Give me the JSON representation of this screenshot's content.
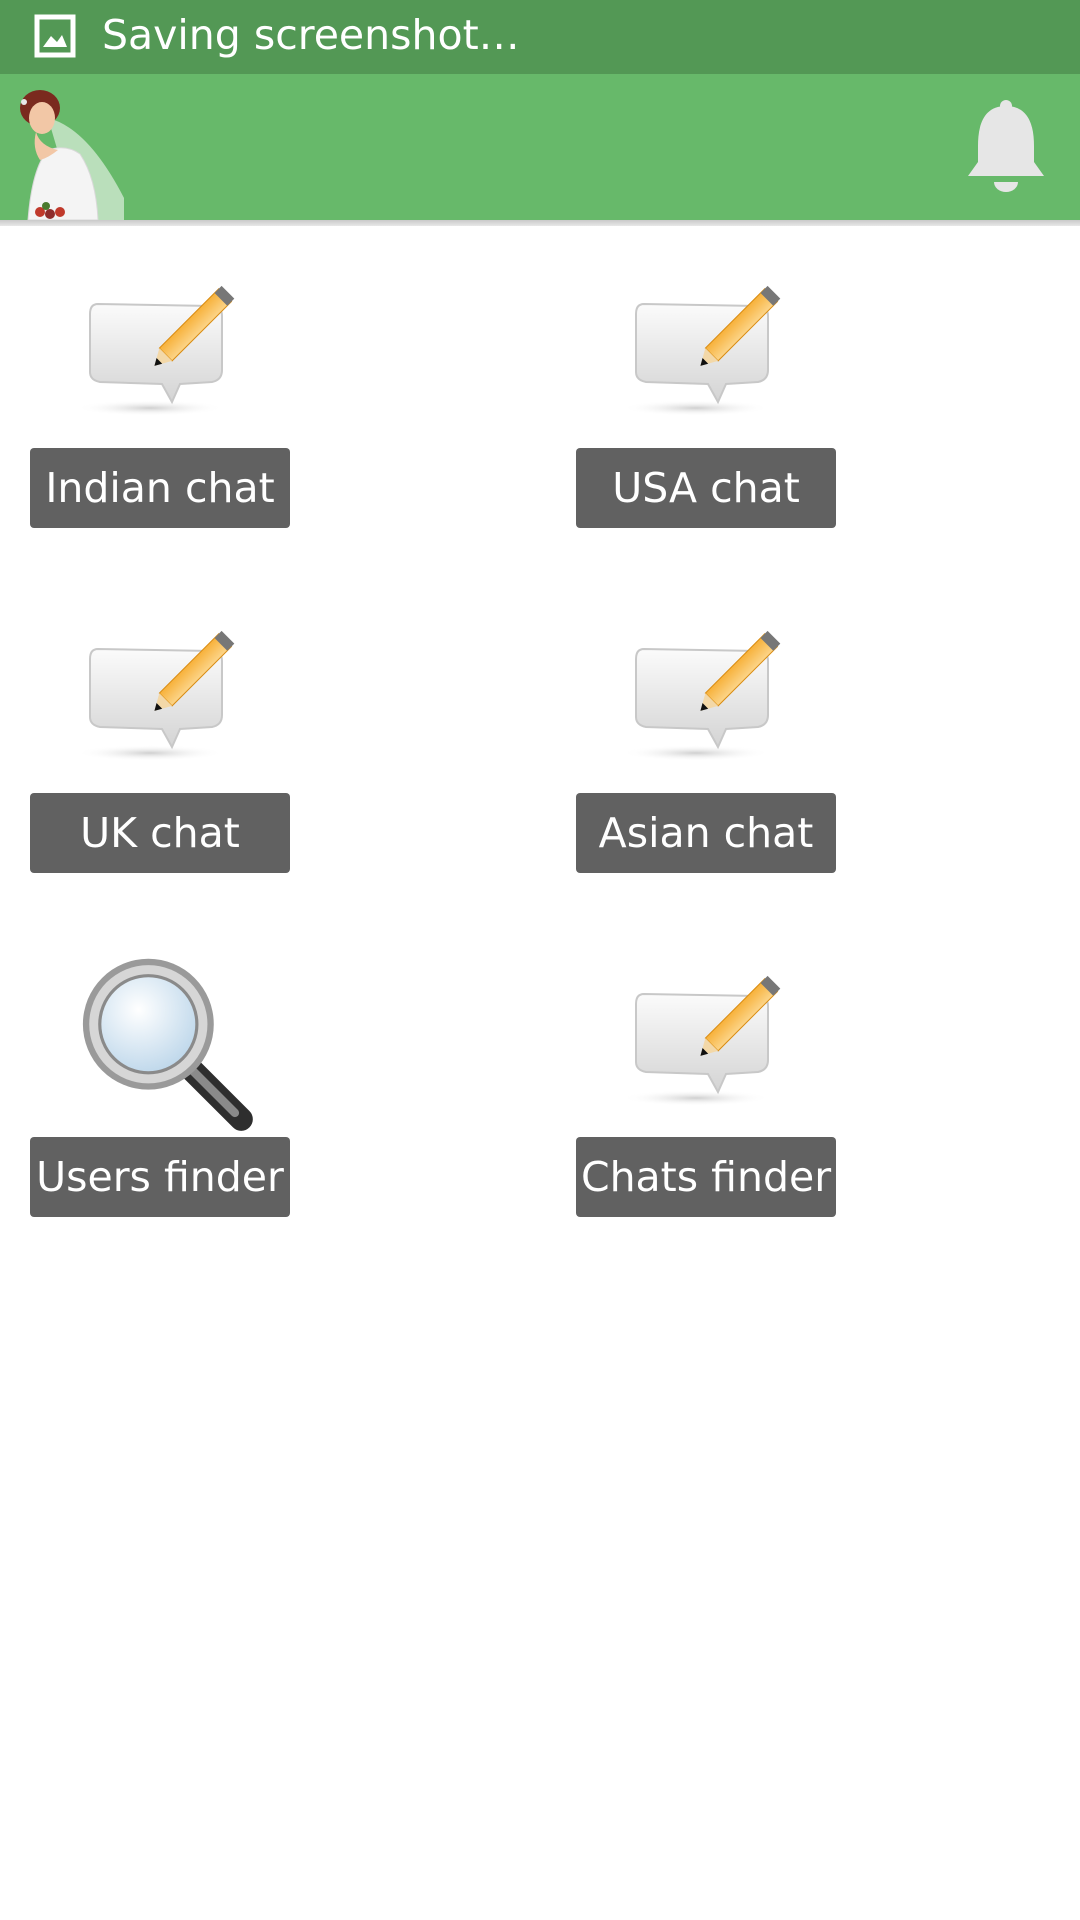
{
  "status_bar": {
    "text": "Saving screenshot…",
    "icon": "image-icon",
    "color": "#539855"
  },
  "app_bar": {
    "color": "#67b96a",
    "avatar": "bride-avatar",
    "notification_icon": "bell-icon"
  },
  "tiles": [
    {
      "label": "Indian chat",
      "icon": "chat-edit-icon"
    },
    {
      "label": "USA chat",
      "icon": "chat-edit-icon"
    },
    {
      "label": "UK chat",
      "icon": "chat-edit-icon"
    },
    {
      "label": "Asian chat",
      "icon": "chat-edit-icon"
    },
    {
      "label": "Users finder",
      "icon": "magnifier-icon"
    },
    {
      "label": "Chats finder",
      "icon": "chat-edit-icon"
    }
  ],
  "button_color": "#616161"
}
